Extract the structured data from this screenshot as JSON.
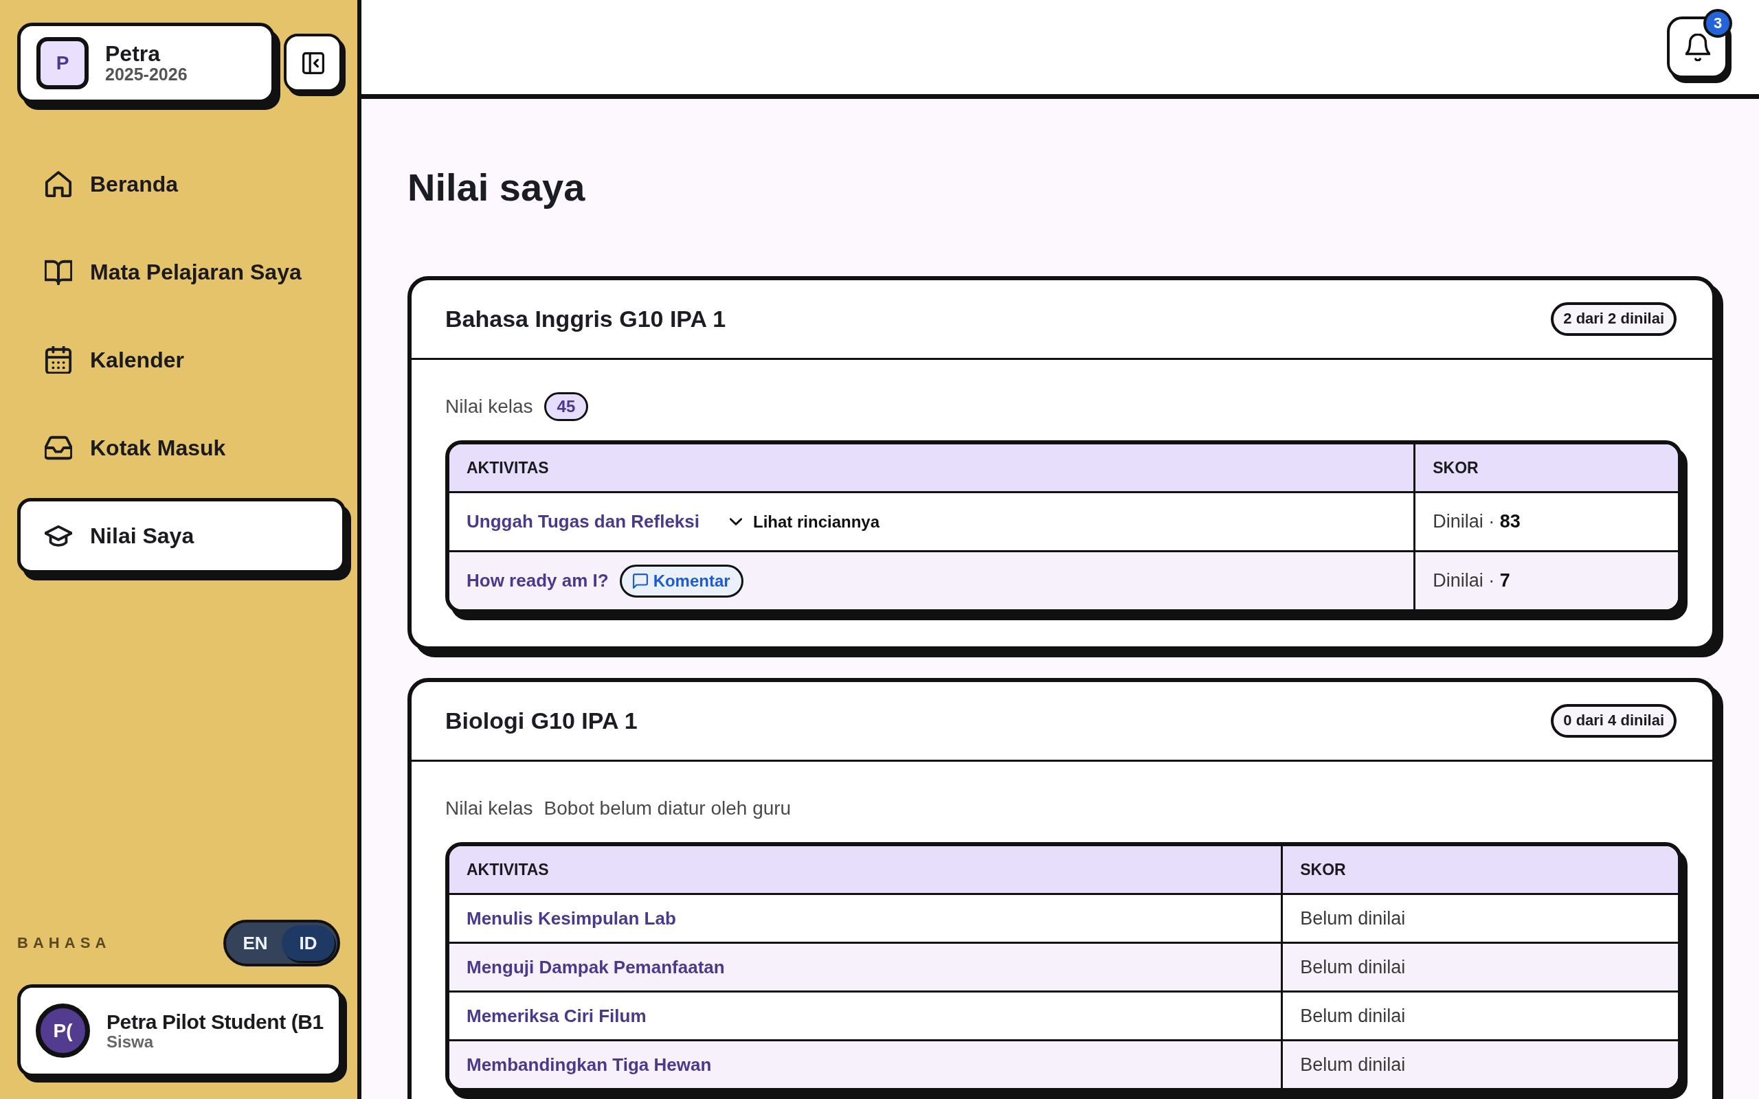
{
  "sidebar": {
    "school": {
      "initial": "P",
      "name": "Petra",
      "year": "2025-2026"
    },
    "nav": [
      {
        "label": "Beranda",
        "selected": false
      },
      {
        "label": "Mata Pelajaran Saya",
        "selected": false
      },
      {
        "label": "Kalender",
        "selected": false
      },
      {
        "label": "Kotak Masuk",
        "selected": false
      },
      {
        "label": "Nilai Saya",
        "selected": true
      }
    ],
    "language": {
      "label": "BAHASA",
      "options": [
        {
          "label": "EN",
          "selected": false
        },
        {
          "label": "ID",
          "selected": true
        }
      ]
    },
    "user": {
      "initials": "P(",
      "name": "Petra Pilot Student (B1",
      "role": "Siswa"
    }
  },
  "header": {
    "notifications": {
      "count": "3"
    }
  },
  "page_title": "Nilai saya",
  "courses": [
    {
      "title": "Bahasa Inggris G10 IPA 1",
      "graded": "2 dari 2 dinilai",
      "class_grade": {
        "label": "Nilai kelas",
        "kind": "score",
        "value": "45"
      },
      "table": {
        "columns": [
          "AKTIVITAS",
          "SKOR"
        ],
        "rows": [
          {
            "activity": "Unggah Tugas dan Refleksi",
            "details": {
              "label": "Lihat rinciannya",
              "expanded": false
            },
            "score": "Dinilai · **83**"
          },
          {
            "activity": "How ready am I?",
            "comment": "Komentar",
            "score": "Dinilai · **7**"
          }
        ]
      }
    },
    {
      "title": "Biologi G10 IPA 1",
      "graded": "0 dari 4 dinilai",
      "class_grade": {
        "label": "Nilai kelas",
        "kind": "note",
        "value": "Bobot belum diatur oleh guru"
      },
      "table": {
        "columns": [
          "AKTIVITAS",
          "SKOR"
        ],
        "rows": [
          {
            "activity": "Menulis Kesimpulan Lab",
            "score": "Belum dinilai"
          },
          {
            "activity": "Menguji Dampak Pemanfaatan",
            "score": "Belum dinilai"
          },
          {
            "activity": "Memeriksa Ciri Filum",
            "score": "Belum dinilai"
          },
          {
            "activity": "Membandingkan Tiga Hewan",
            "score": "Belum dinilai"
          }
        ]
      }
    }
  ]
}
